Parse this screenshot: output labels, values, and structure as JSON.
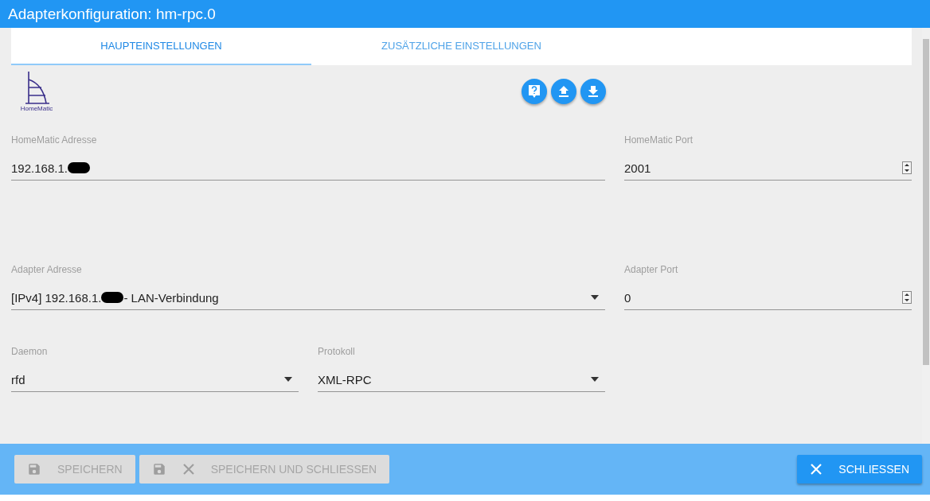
{
  "window": {
    "title": "Adapterkonfiguration: hm-rpc.0"
  },
  "tabs": [
    {
      "label": "HAUPTEINSTELLUNGEN",
      "selected": true
    },
    {
      "label": "ZUSÄTZLICHE EINSTELLUNGEN",
      "selected": false
    }
  ],
  "logo": {
    "caption": "HomeMatic"
  },
  "toolbar": [
    {
      "kind": "help"
    },
    {
      "kind": "upload"
    },
    {
      "kind": "download"
    }
  ],
  "rows": [
    [
      {
        "kind": "text",
        "label": "HomeMatic Adresse",
        "value": "192.168.1.",
        "redacted": true
      },
      {
        "kind": "number",
        "label": "HomeMatic Port",
        "value": "2001"
      }
    ],
    [
      {
        "kind": "select",
        "label": "Adapter Adresse",
        "value": "[IPv4] 192.168.1.",
        "redacted": true,
        "suffix": "- LAN-Verbindung"
      },
      {
        "kind": "number",
        "label": "Adapter Port",
        "value": "0"
      }
    ],
    [
      {
        "kind": "select",
        "label": "Daemon",
        "value": "rfd"
      },
      {
        "kind": "select",
        "label": "Protokoll",
        "value": "XML-RPC"
      }
    ]
  ],
  "footer": {
    "buttons": [
      {
        "label": "SPEICHERN",
        "kind": "save",
        "disabled": true
      },
      {
        "label": "SPEICHERN UND SCHLIESSEN",
        "kind": "save_close",
        "disabled": true
      }
    ],
    "close": {
      "label": "SCHLIESSEN",
      "kind": "close",
      "disabled": false
    }
  }
}
